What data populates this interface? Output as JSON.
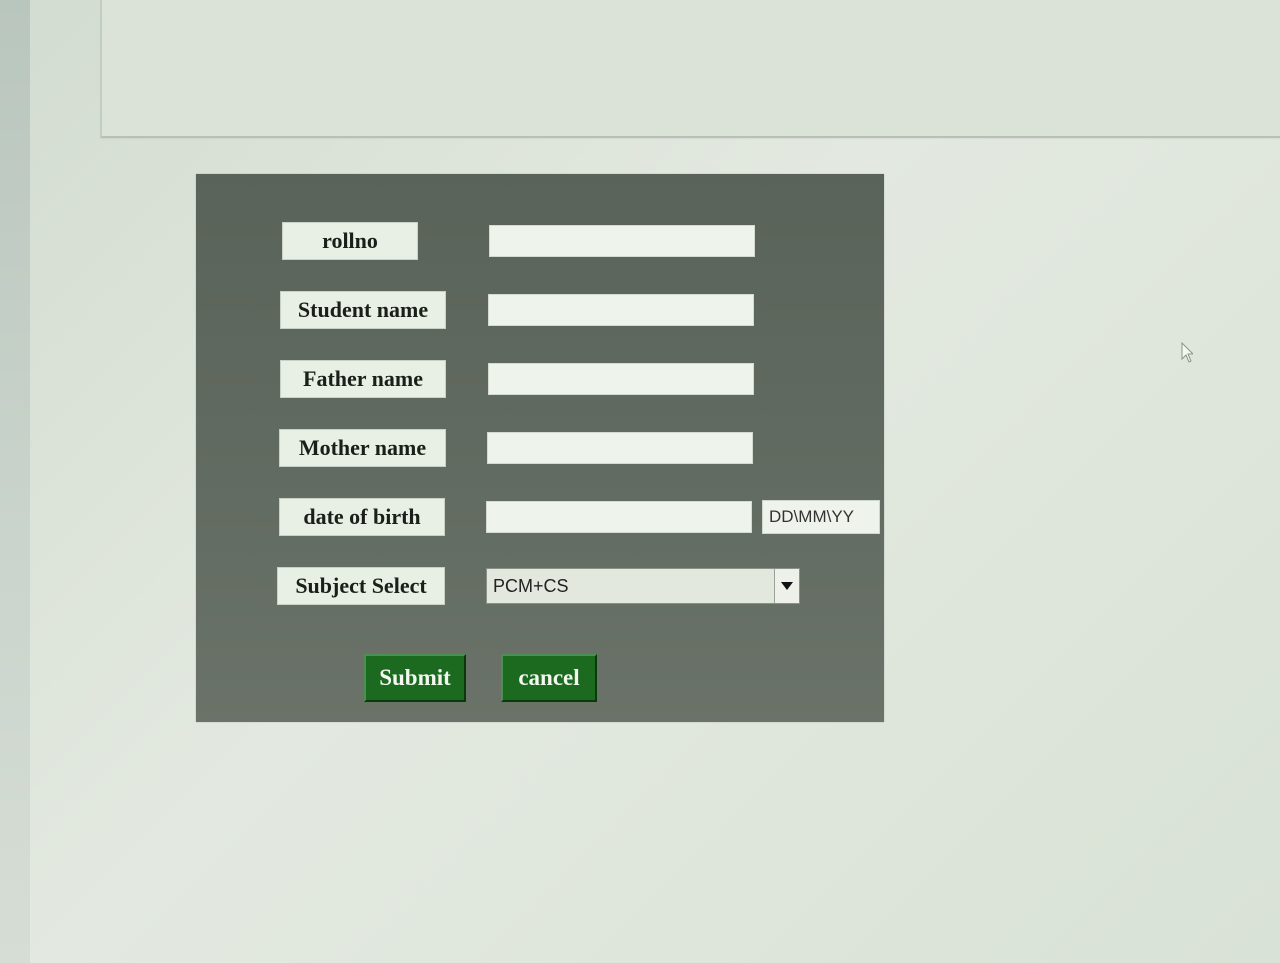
{
  "form": {
    "fields": [
      {
        "label": "rollno",
        "value": ""
      },
      {
        "label": "Student name",
        "value": ""
      },
      {
        "label": "Father name",
        "value": ""
      },
      {
        "label": "Mother name",
        "value": ""
      },
      {
        "label": "date of birth",
        "value": "",
        "hint": "DD\\MM\\YY"
      }
    ],
    "subject": {
      "label": "Subject Select",
      "selected": "PCM+CS"
    },
    "buttons": {
      "submit_label": "Submit",
      "cancel_label": "cancel"
    }
  },
  "colors": {
    "form_background": "#626b61",
    "button_green": "#1c6a20",
    "label_background": "#e8efe5"
  },
  "icons": {
    "dropdown": "triangle-down-icon",
    "cursor": "mouse-pointer-icon"
  }
}
